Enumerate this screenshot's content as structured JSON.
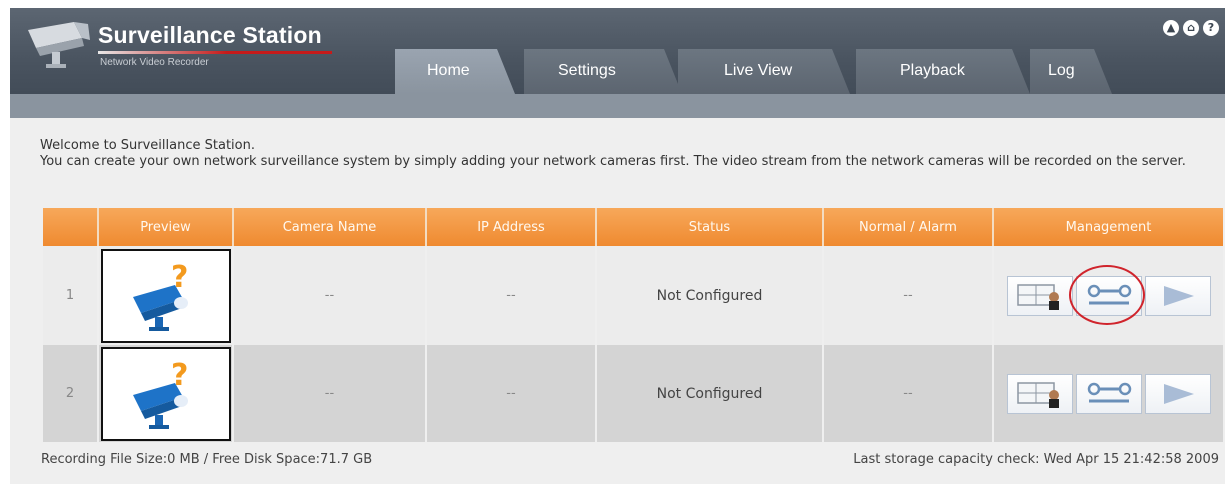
{
  "header": {
    "title": "Surveillance Station",
    "subtitle": "Network Video Recorder",
    "colors": {
      "header_bg": "#4a5460",
      "accent_line": "#c61a1a",
      "table_header": "#f39a44"
    },
    "top_icons": [
      "logout-icon",
      "home-icon",
      "help-icon"
    ]
  },
  "tabs": [
    {
      "label": "Home",
      "active": true
    },
    {
      "label": "Settings",
      "active": false
    },
    {
      "label": "Live View",
      "active": false
    },
    {
      "label": "Playback",
      "active": false
    },
    {
      "label": "Log",
      "active": false
    }
  ],
  "welcome": {
    "line1": "Welcome to Surveillance Station.",
    "line2": "You can create your own network surveillance system by simply adding your network cameras first. The video stream from the network cameras will be recorded on the server."
  },
  "table": {
    "columns": [
      "",
      "Preview",
      "Camera Name",
      "IP Address",
      "Status",
      "Normal / Alarm",
      "Management"
    ],
    "rows": [
      {
        "index": "1",
        "camera_name": "--",
        "ip_address": "--",
        "status": "Not Configured",
        "normal_alarm": "--"
      },
      {
        "index": "2",
        "camera_name": "--",
        "ip_address": "--",
        "status": "Not Configured",
        "normal_alarm": "--"
      }
    ],
    "management_icons": [
      "live-view-icon",
      "edit-settings-icon",
      "play-icon"
    ]
  },
  "footer": {
    "left": "Recording File Size:0 MB / Free Disk Space:71.7 GB",
    "right": "Last storage capacity check: Wed Apr 15 21:42:58 2009"
  }
}
